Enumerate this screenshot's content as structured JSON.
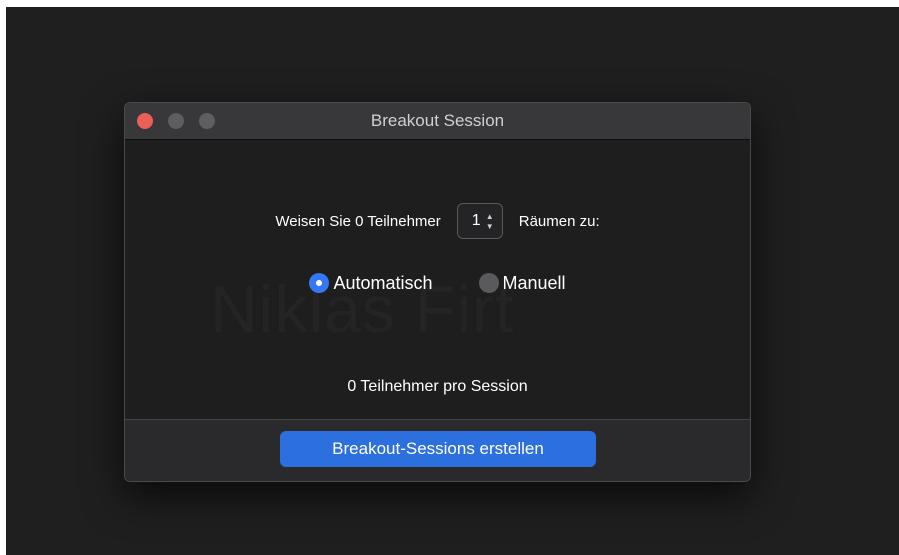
{
  "window": {
    "title": "Breakout Session",
    "watermark": "Niklas Firt"
  },
  "assign": {
    "prefix": "Weisen Sie 0 Teilnehmer",
    "rooms_value": "1",
    "suffix": "Räumen zu:"
  },
  "mode": {
    "automatic_label": "Automatisch",
    "manual_label": "Manuell",
    "selected": "automatic"
  },
  "summary": {
    "per_session": "0 Teilnehmer pro Session"
  },
  "footer": {
    "create_label": "Breakout-Sessions erstellen"
  },
  "colors": {
    "accent": "#2c6fdf",
    "radio_selected": "#3478f6",
    "close": "#ec5f57"
  }
}
